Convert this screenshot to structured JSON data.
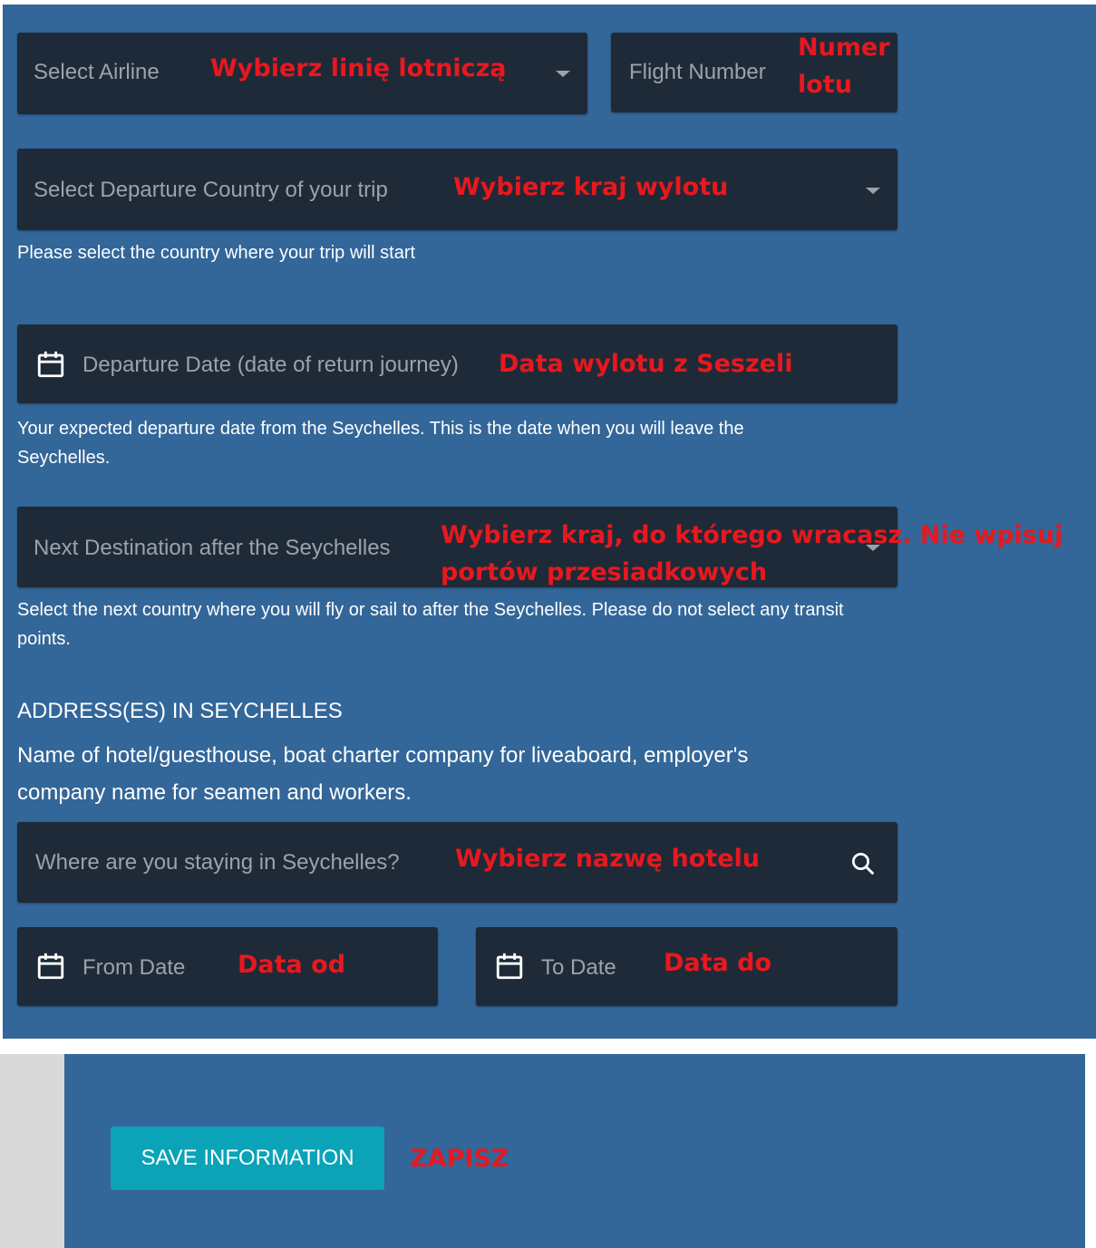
{
  "form": {
    "airline": {
      "placeholder": "Select Airline",
      "annotation": "Wybierz linię lotniczą"
    },
    "flight_number": {
      "placeholder": "Flight Number",
      "annotation_line1": "Numer",
      "annotation_line2": "lotu"
    },
    "departure_country": {
      "placeholder": "Select Departure Country of your trip",
      "annotation": "Wybierz kraj wylotu",
      "help": "Please select the country where your trip will start"
    },
    "departure_date": {
      "placeholder": "Departure Date (date of return journey)",
      "annotation": "Data wylotu z Seszeli",
      "help": "Your expected departure date from the Seychelles. This is the date when you will leave the Seychelles."
    },
    "next_destination": {
      "placeholder": "Next Destination after the Seychelles",
      "annotation_line1": "Wybierz kraj, do którego wracasz. Nie wpisuj",
      "annotation_line2": "portów przesiadkowych",
      "help": "Select the next country where you will fly or sail to after the Seychelles. Please do not select any transit points."
    },
    "address_section": {
      "title": "ADDRESS(ES) IN SEYCHELLES",
      "description": "Name of hotel/guesthouse, boat charter company for liveaboard, employer's company name for seamen and workers."
    },
    "stay": {
      "placeholder": "Where are you staying in Seychelles?",
      "annotation": "Wybierz nazwę hotelu"
    },
    "from_date": {
      "placeholder": "From Date",
      "annotation": "Data od"
    },
    "to_date": {
      "placeholder": "To Date",
      "annotation": "Data do"
    }
  },
  "actions": {
    "save_label": "SAVE INFORMATION",
    "save_annotation": "ZAPISZ"
  },
  "icons": {
    "dropdown": "caret-down-icon",
    "calendar": "calendar-icon",
    "search": "search-icon"
  },
  "colors": {
    "panel_bg": "#336699",
    "field_bg": "#1e2a38",
    "placeholder": "#9aa3ad",
    "annotation": "#e8181e",
    "button_bg": "#0aa3b8",
    "side_gray": "#d9d9d9"
  }
}
